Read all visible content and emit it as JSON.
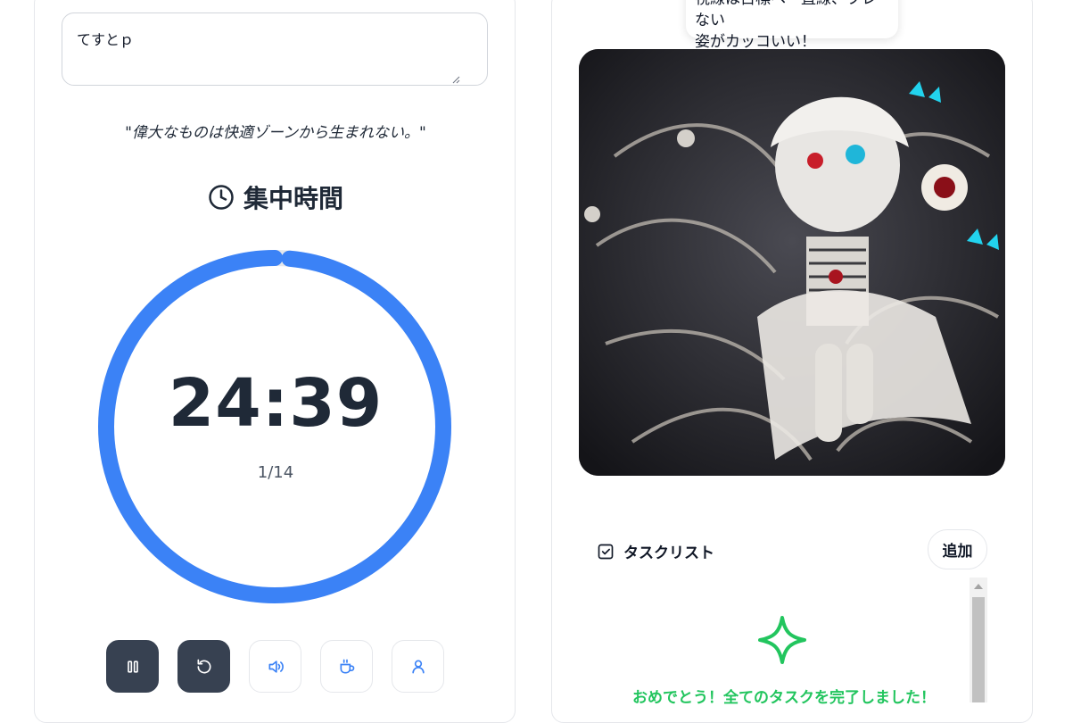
{
  "memo": {
    "value": "てすとｐ"
  },
  "quote": "\"偉大なものは快適ゾーンから生まれない。\"",
  "timer": {
    "mode_label": "集中時間",
    "time": "24:39",
    "session": "1/14",
    "progress_remaining": 0.986,
    "colors": {
      "track": "#e5e7eb",
      "progress": "#3b82f6"
    }
  },
  "controls": [
    {
      "name": "pause-button",
      "icon": "pause-icon"
    },
    {
      "name": "reset-button",
      "icon": "reset-icon"
    },
    {
      "name": "sound-button",
      "icon": "volume-icon"
    },
    {
      "name": "break-button",
      "icon": "coffee-icon"
    },
    {
      "name": "profile-button",
      "icon": "user-icon"
    }
  ],
  "character": {
    "speech_line1": "視線は目標へ一直線、ブレない",
    "speech_line2": "姿がカッコいい！"
  },
  "tasks": {
    "title": "タスクリスト",
    "add_label": "追加",
    "empty_message": "おめでとう！全てのタスクを完了しました！"
  },
  "colors": {
    "accent": "#3b82f6",
    "success": "#22c55e",
    "dark_button": "#374151"
  }
}
